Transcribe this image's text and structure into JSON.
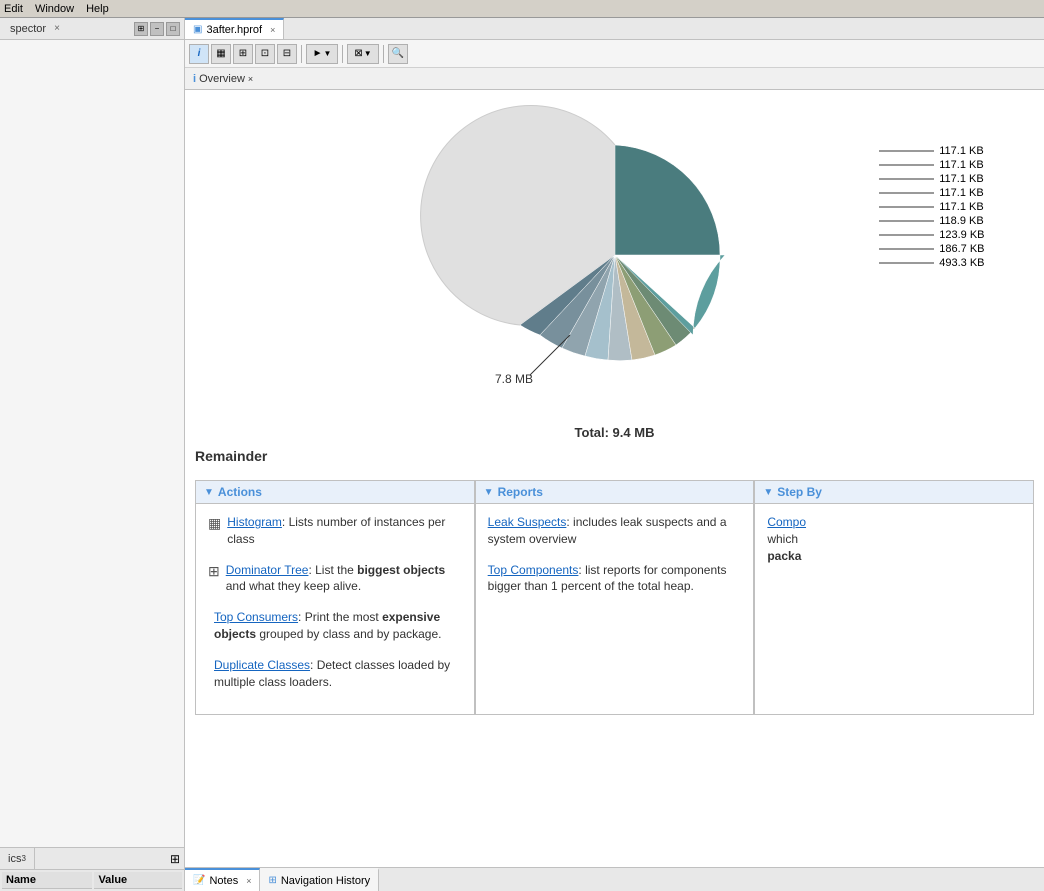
{
  "menuBar": {
    "items": [
      "Edit",
      "Window",
      "Help"
    ]
  },
  "leftPanel": {
    "tabLabel": "spector",
    "closeLabel": "×",
    "pinLabel": "⊞",
    "minLabel": "−",
    "maxLabel": "□",
    "bottomTabs": [
      {
        "label": "ics",
        "superscript": "3"
      }
    ],
    "tableHeaders": [
      "Name",
      "Value"
    ],
    "pinIcon": "⊞"
  },
  "mainPanel": {
    "tab": {
      "icon": "▣",
      "label": "3after.hprof",
      "close": "×"
    },
    "toolbar": {
      "buttons": [
        "i",
        "▦",
        "⊞",
        "⊡",
        "⊟",
        "►",
        "▼",
        "⊠",
        "▼",
        "🔍"
      ]
    },
    "overviewTab": {
      "icon": "i",
      "label": "Overview",
      "close": "×"
    }
  },
  "chart": {
    "total": "Total: 9.4 MB",
    "leftLabel": "7.8 MB",
    "legendItems": [
      "117.1 KB",
      "117.1 KB",
      "117.1 KB",
      "117.1 KB",
      "117.1 KB",
      "118.9 KB",
      "123.9 KB",
      "186.7 KB",
      "493.3 KB"
    ]
  },
  "remainderLabel": "Remainder",
  "panels": {
    "actions": {
      "title": "Actions",
      "items": [
        {
          "linkText": "Histogram",
          "description": ": Lists number of instances per class",
          "icon": "▦"
        },
        {
          "linkText": "Dominator Tree",
          "descPart1": ": List the ",
          "bold1": "biggest objects",
          "descPart2": " and what they keep alive.",
          "icon": "⊞"
        },
        {
          "linkText": "Top Consumers",
          "descPart1": ": Print the most ",
          "bold1": "expensive objects",
          "descPart2": " grouped by class and by package.",
          "icon": ""
        },
        {
          "linkText": "Duplicate Classes",
          "description": ": Detect classes loaded by multiple class loaders.",
          "icon": ""
        }
      ]
    },
    "reports": {
      "title": "Reports",
      "items": [
        {
          "linkText": "Leak Suspects",
          "description": ": includes leak suspects and a system overview"
        },
        {
          "linkText": "Top Components",
          "description": ": list reports for components bigger than 1 percent of the total heap."
        }
      ]
    },
    "stepBy": {
      "title": "Step By",
      "partialText": "Compo... which packa..."
    }
  },
  "bottomTabs": [
    {
      "label": "Notes",
      "icon": "📝",
      "close": "×",
      "active": true
    },
    {
      "label": "Navigation History",
      "icon": "⊞",
      "close": null,
      "active": false
    }
  ]
}
